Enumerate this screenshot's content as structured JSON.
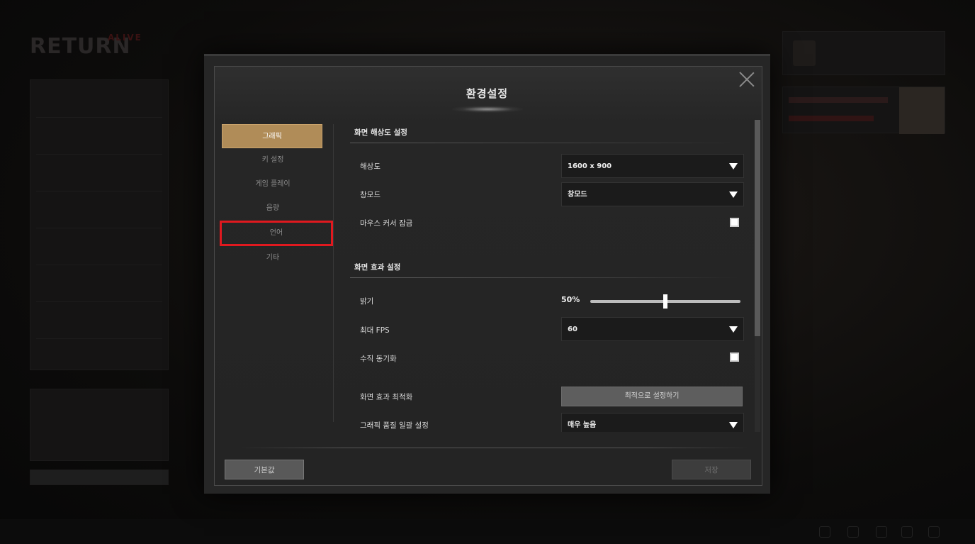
{
  "background": {
    "logo_main": "RETURN",
    "logo_sub": "ALIVE"
  },
  "modal": {
    "title": "환경설정",
    "nav": [
      {
        "label": "그래픽",
        "active": true
      },
      {
        "label": "키 설정"
      },
      {
        "label": "게임 플레이"
      },
      {
        "label": "음량"
      },
      {
        "label": "언어",
        "highlighted": true
      },
      {
        "label": "기타"
      }
    ],
    "sections": {
      "resolution": {
        "title": "화면 해상도 설정",
        "resolution_label": "해상도",
        "resolution_value": "1600 x 900",
        "window_mode_label": "창모드",
        "window_mode_value": "창모드",
        "cursor_lock_label": "마우스 커서 잠금"
      },
      "effects": {
        "title": "화면 효과 설정",
        "brightness_label": "밝기",
        "brightness_value": "50%",
        "brightness_fraction": 0.5,
        "fps_label": "최대 FPS",
        "fps_value": "60",
        "vsync_label": "수직 동기화",
        "optimize_label": "화면 효과 최적화",
        "optimize_button": "최적으로 설정하기",
        "quality_label": "그래픽 품질 일괄 설정",
        "quality_value": "매우 높음"
      }
    },
    "footer": {
      "default_button": "기본값",
      "save_button": "저장"
    }
  },
  "colors": {
    "accent": "#b08c58",
    "highlight": "#e0191f"
  }
}
